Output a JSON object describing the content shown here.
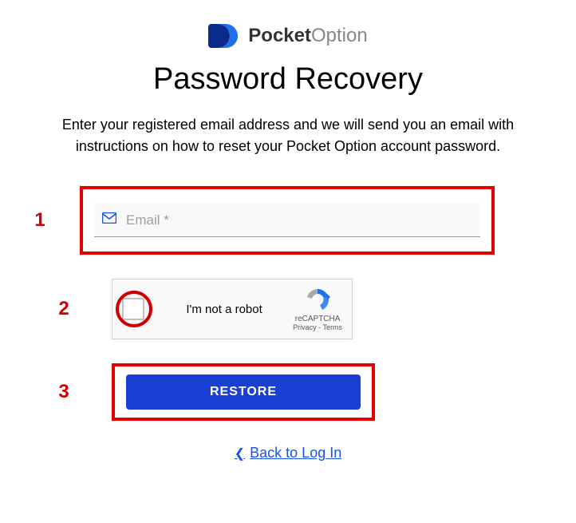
{
  "brand": {
    "name_bold": "Pocket",
    "name_light": "Option"
  },
  "page": {
    "title": "Password Recovery",
    "description": "Enter your registered email address and we will send you an email with instructions on how to reset your Pocket Option account password."
  },
  "steps": {
    "one": "1",
    "two": "2",
    "three": "3"
  },
  "email": {
    "placeholder": "Email *",
    "value": ""
  },
  "recaptcha": {
    "label": "I'm not a robot",
    "brand": "reCAPTCHA",
    "legal": "Privacy - Terms"
  },
  "actions": {
    "restore": "RESTORE",
    "back": "Back to Log In"
  }
}
